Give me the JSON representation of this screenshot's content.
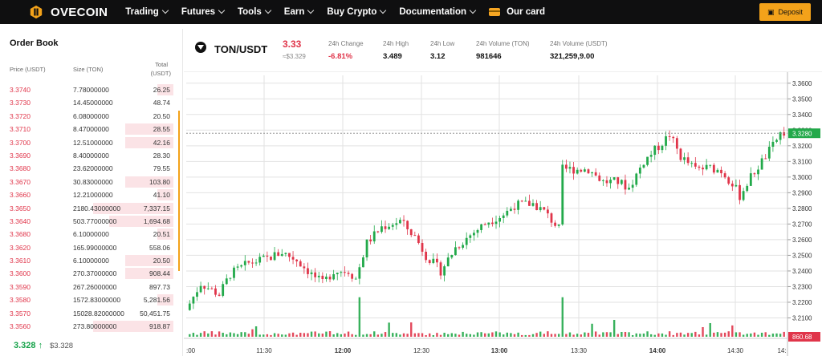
{
  "brand": {
    "name": "OVECOIN"
  },
  "nav": {
    "items": [
      {
        "label": "Trading",
        "dropdown": true
      },
      {
        "label": "Futures",
        "dropdown": true
      },
      {
        "label": "Tools",
        "dropdown": true
      },
      {
        "label": "Earn",
        "dropdown": true
      },
      {
        "label": "Buy Crypto",
        "dropdown": true
      },
      {
        "label": "Documentation",
        "dropdown": true
      }
    ],
    "card_label": "Our card",
    "deposit_label": "Deposit"
  },
  "orderbook": {
    "title": "Order Book",
    "headers": {
      "price": "Price (USDT)",
      "size": "Size (TON)",
      "total_line1": "Total",
      "total_line2": "(USDT)"
    },
    "rows": [
      {
        "price": "3.3740",
        "size": "7.78000000",
        "total": "26.25",
        "depth": 0.2
      },
      {
        "price": "3.3730",
        "size": "14.45000000",
        "total": "48.74",
        "depth": 0
      },
      {
        "price": "3.3720",
        "size": "6.08000000",
        "total": "20.50",
        "depth": 0
      },
      {
        "price": "3.3710",
        "size": "8.47000000",
        "total": "28.55",
        "depth": 0.6
      },
      {
        "price": "3.3700",
        "size": "12.51000000",
        "total": "42.16",
        "depth": 0.6
      },
      {
        "price": "3.3690",
        "size": "8.40000000",
        "total": "28.30",
        "depth": 0
      },
      {
        "price": "3.3680",
        "size": "23.62000000",
        "total": "79.55",
        "depth": 0
      },
      {
        "price": "3.3670",
        "size": "30.83000000",
        "total": "103.80",
        "depth": 0.6
      },
      {
        "price": "3.3660",
        "size": "12.21000000",
        "total": "41.10",
        "depth": 0.2
      },
      {
        "price": "3.3650",
        "size": "2180.43000000",
        "total": "7,337.15",
        "depth": 1.0
      },
      {
        "price": "3.3640",
        "size": "503.77000000",
        "total": "1,694.68",
        "depth": 0.8
      },
      {
        "price": "3.3680",
        "size": "6.10000000",
        "total": "20.51",
        "depth": 0.2
      },
      {
        "price": "3.3620",
        "size": "165.99000000",
        "total": "558.06",
        "depth": 0
      },
      {
        "price": "3.3610",
        "size": "6.10000000",
        "total": "20.50",
        "depth": 0.6
      },
      {
        "price": "3.3600",
        "size": "270.37000000",
        "total": "908.44",
        "depth": 0.6
      },
      {
        "price": "3.3590",
        "size": "267.26000000",
        "total": "897.73",
        "depth": 0
      },
      {
        "price": "3.3580",
        "size": "1572.83000000",
        "total": "5,281.56",
        "depth": 0.2
      },
      {
        "price": "3.3570",
        "size": "15028.82000000",
        "total": "50,451.75",
        "depth": 0
      },
      {
        "price": "3.3560",
        "size": "273.80000000",
        "total": "918.87",
        "depth": 1.0
      }
    ],
    "last_price": "3.328",
    "last_arrow": "↑",
    "last_price_usd": "$3.328"
  },
  "ticker": {
    "pair": "TON/USDT",
    "price": "3.33",
    "price_usd": "≈$3.329",
    "stats": [
      {
        "label": "24h Change",
        "value": "-6.81%",
        "negative": true
      },
      {
        "label": "24h High",
        "value": "3.489"
      },
      {
        "label": "24h Low",
        "value": "3.12"
      },
      {
        "label": "24h Volume (TON)",
        "value": "981646"
      },
      {
        "label": "24h Volume (USDT)",
        "value": "321,259,9.00"
      }
    ]
  },
  "chart_data": {
    "type": "candlestick",
    "y_ticks": [
      "3.3600",
      "3.3500",
      "3.3400",
      "3.3300",
      "3.3200",
      "3.3100",
      "3.3000",
      "3.2900",
      "3.2800",
      "3.2700",
      "3.2600",
      "3.2500",
      "3.2400",
      "3.2300",
      "3.2200",
      "3.2100"
    ],
    "x_ticks": [
      ":00",
      "11:30",
      "12:00",
      "12:30",
      "13:00",
      "13:30",
      "14:00",
      "14:30",
      "14:"
    ],
    "bold_x_ticks": [
      "12:00",
      "13:00",
      "14:00"
    ],
    "ylim": [
      3.2,
      3.365
    ],
    "current_price_label": "3.3280",
    "current_price": 3.328,
    "volume_label": "860.68",
    "path": [
      [
        0,
        3.215
      ],
      [
        4,
        3.232
      ],
      [
        9,
        3.225
      ],
      [
        12,
        3.238
      ],
      [
        17,
        3.245
      ],
      [
        22,
        3.248
      ],
      [
        26,
        3.252
      ],
      [
        30,
        3.247
      ],
      [
        34,
        3.238
      ],
      [
        37,
        3.232
      ],
      [
        40,
        3.24
      ],
      [
        44,
        3.24
      ],
      [
        46,
        3.235
      ],
      [
        49,
        3.258
      ],
      [
        53,
        3.268
      ],
      [
        58,
        3.272
      ],
      [
        62,
        3.262
      ],
      [
        65,
        3.25
      ],
      [
        69,
        3.24
      ],
      [
        73,
        3.255
      ],
      [
        77,
        3.263
      ],
      [
        82,
        3.272
      ],
      [
        86,
        3.276
      ],
      [
        89,
        3.282
      ],
      [
        94,
        3.283
      ],
      [
        97,
        3.278
      ],
      [
        101,
        3.267
      ],
      [
        102,
        3.305
      ],
      [
        105,
        3.305
      ],
      [
        109,
        3.305
      ],
      [
        113,
        3.297
      ],
      [
        117,
        3.297
      ],
      [
        120,
        3.293
      ],
      [
        124,
        3.31
      ],
      [
        129,
        3.322
      ],
      [
        131,
        3.327
      ],
      [
        134,
        3.313
      ],
      [
        138,
        3.305
      ],
      [
        142,
        3.306
      ],
      [
        145,
        3.304
      ],
      [
        148,
        3.296
      ],
      [
        150,
        3.288
      ],
      [
        153,
        3.3
      ],
      [
        156,
        3.31
      ],
      [
        159,
        3.32
      ],
      [
        161,
        3.328
      ]
    ],
    "volume_spikes": [
      [
        46,
        0.85
      ],
      [
        101,
        0.85
      ]
    ]
  }
}
